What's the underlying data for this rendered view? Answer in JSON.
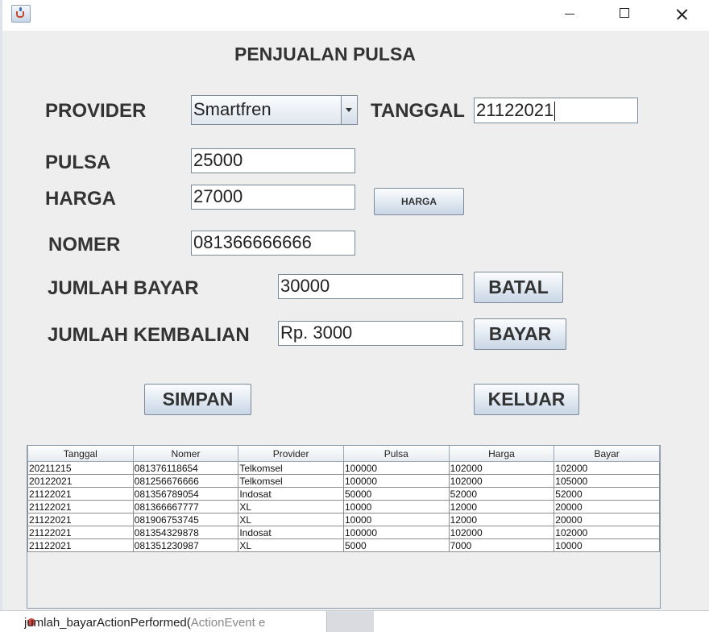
{
  "header": {
    "title": "PENJUALAN PULSA"
  },
  "form": {
    "provider": {
      "label": "PROVIDER",
      "value": "Smartfren"
    },
    "tanggal": {
      "label": "TANGGAL",
      "value": "21122021"
    },
    "pulsa": {
      "label": "PULSA",
      "value": "25000"
    },
    "harga": {
      "label": "HARGA",
      "value": "27000",
      "button_label": "HARGA"
    },
    "nomer": {
      "label": "NOMER",
      "value": "081366666666"
    },
    "jumlah_bayar": {
      "label": "JUMLAH BAYAR",
      "value": "30000"
    },
    "jumlah_kembalian": {
      "label": "JUMLAH KEMBALIAN",
      "value": "Rp. 3000"
    }
  },
  "buttons": {
    "batal": "BATAL",
    "bayar": "BAYAR",
    "simpan": "SIMPAN",
    "keluar": "KELUAR"
  },
  "table": {
    "columns": [
      "Tanggal",
      "Nomer",
      "Provider",
      "Pulsa",
      "Harga",
      "Bayar"
    ],
    "rows": [
      [
        "20211215",
        "081376118654",
        "Telkomsel",
        "100000",
        "102000",
        "102000"
      ],
      [
        "20122021",
        "081256676666",
        "Telkomsel",
        "100000",
        "102000",
        "105000"
      ],
      [
        "21122021",
        "081356789054",
        "Indosat",
        "50000",
        "52000",
        "52000"
      ],
      [
        "21122021",
        "081366667777",
        "XL",
        "10000",
        "12000",
        "20000"
      ],
      [
        "21122021",
        "081906753745",
        "XL",
        "10000",
        "12000",
        "20000"
      ],
      [
        "21122021",
        "081354329878",
        "Indosat",
        "100000",
        "102000",
        "102000"
      ],
      [
        "21122021",
        "081351230987",
        "XL",
        "5000",
        "7000",
        "10000"
      ]
    ]
  },
  "background_editor": {
    "code_text": "jumlah_bayarActionPerformed(",
    "code_arg": "ActionEvent e"
  },
  "icons": {
    "app": "java-cup-icon",
    "minimize": "minimize-icon",
    "maximize": "maximize-icon",
    "close": "close-icon",
    "dropdown": "chevron-down-icon"
  }
}
